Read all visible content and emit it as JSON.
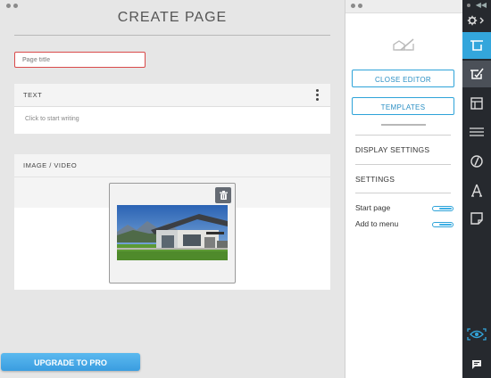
{
  "editor": {
    "heading": "CREATE PAGE",
    "title_placeholder": "Page title",
    "text_block": {
      "label": "TEXT",
      "placeholder": "Click to start writing"
    },
    "media_block": {
      "label": "IMAGE / VIDEO"
    },
    "upgrade_label": "UPGRADE TO PRO"
  },
  "panel": {
    "close_editor_label": "CLOSE EDITOR",
    "templates_label": "TEMPLATES",
    "display_settings_label": "DISPLAY SETTINGS",
    "settings_label": "SETTINGS",
    "toggles": [
      {
        "label": "Start page",
        "on": true
      },
      {
        "label": "Add to menu",
        "on": true
      }
    ]
  },
  "sidebar": {
    "icons": [
      "settings-icon",
      "page-icon",
      "edit-icon",
      "layout-icon",
      "menu-icon",
      "design-icon",
      "font-icon",
      "template-icon",
      "preview-icon",
      "chat-icon"
    ]
  },
  "colors": {
    "accent": "#33a6dc",
    "error_border": "#d94a4a",
    "sidebar_bg": "#26292e",
    "upgrade_button": "#4aaee8"
  }
}
